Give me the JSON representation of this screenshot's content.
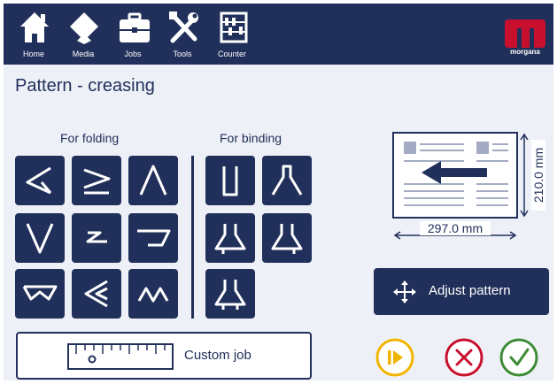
{
  "nav": {
    "items": [
      {
        "label": "Home",
        "icon": "home-icon"
      },
      {
        "label": "Media",
        "icon": "media-icon"
      },
      {
        "label": "Jobs",
        "icon": "jobs-icon"
      },
      {
        "label": "Tools",
        "icon": "tools-icon"
      },
      {
        "label": "Counter",
        "icon": "counter-icon"
      }
    ],
    "logo_text": "morgana",
    "logo_letter": "m"
  },
  "page": {
    "title": "Pattern - creasing"
  },
  "groups": {
    "folding": {
      "title": "For folding",
      "patterns": [
        "crease-pattern-1",
        "crease-pattern-2",
        "crease-pattern-3",
        "crease-pattern-4",
        "crease-pattern-5",
        "crease-pattern-6",
        "crease-pattern-7",
        "crease-pattern-8",
        "crease-pattern-9"
      ]
    },
    "binding": {
      "title": "For binding",
      "patterns": [
        "binding-pattern-1",
        "binding-pattern-2",
        "binding-pattern-3",
        "binding-pattern-4",
        "binding-pattern-5"
      ]
    }
  },
  "sheet": {
    "width": "297.0 mm",
    "height": "210.0 mm",
    "feed_direction": "left"
  },
  "actions": {
    "adjust_label": "Adjust pattern",
    "custom_label": "Custom job"
  },
  "colors": {
    "navy": "#21305a",
    "accent_red": "#c8102e",
    "play_yellow": "#f0b400",
    "cancel_red": "#c8102e",
    "ok_green": "#3d8b37"
  }
}
